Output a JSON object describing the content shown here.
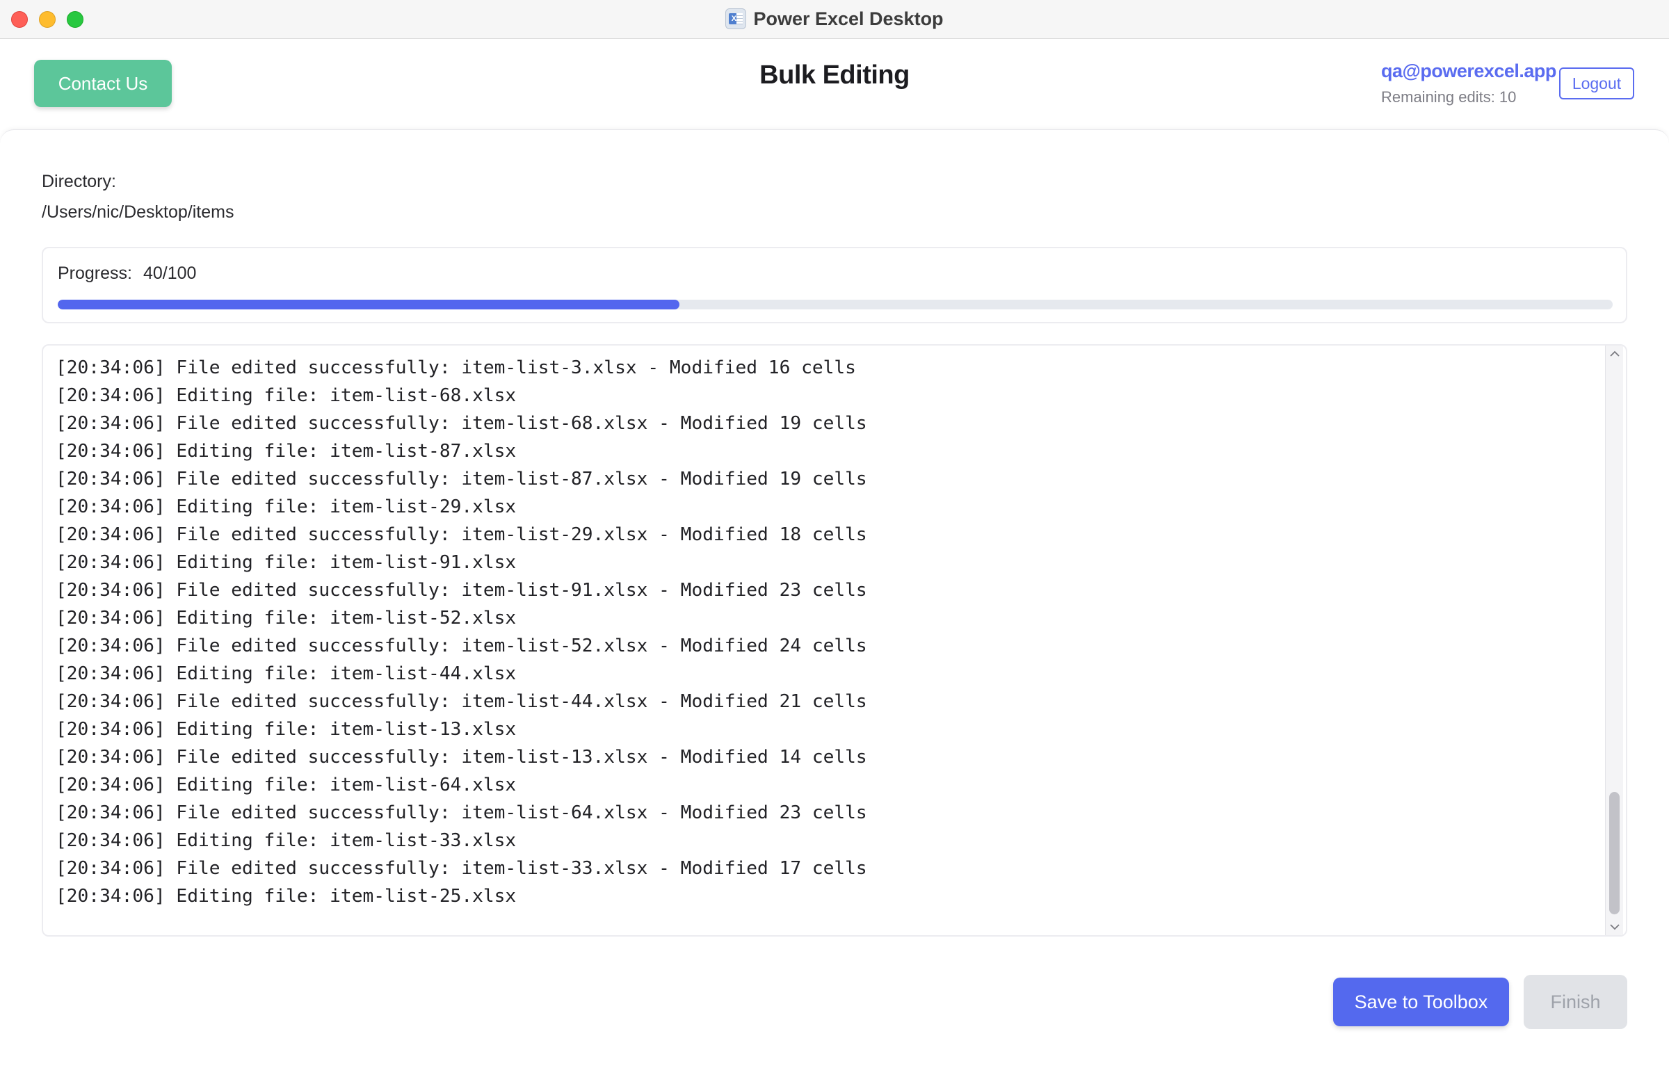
{
  "window": {
    "title": "Power Excel Desktop",
    "icon": "excel-app-icon",
    "icon_letter": "X"
  },
  "header": {
    "contact_label": "Contact Us",
    "page_title": "Bulk Editing",
    "user_email": "qa@powerexcel.app",
    "remaining_label": "Remaining edits:",
    "remaining_count": "10",
    "logout_label": "Logout"
  },
  "directory": {
    "label": "Directory:",
    "path": "/Users/nic/Desktop/items"
  },
  "progress": {
    "label": "Progress:",
    "text": "40/100",
    "done": 40,
    "total": 100,
    "fraction": 0.4
  },
  "log": {
    "lines": [
      "[20:34:06] File edited successfully: item-list-3.xlsx - Modified 16 cells",
      "[20:34:06] Editing file: item-list-68.xlsx",
      "[20:34:06] File edited successfully: item-list-68.xlsx - Modified 19 cells",
      "[20:34:06] Editing file: item-list-87.xlsx",
      "[20:34:06] File edited successfully: item-list-87.xlsx - Modified 19 cells",
      "[20:34:06] Editing file: item-list-29.xlsx",
      "[20:34:06] File edited successfully: item-list-29.xlsx - Modified 18 cells",
      "[20:34:06] Editing file: item-list-91.xlsx",
      "[20:34:06] File edited successfully: item-list-91.xlsx - Modified 23 cells",
      "[20:34:06] Editing file: item-list-52.xlsx",
      "[20:34:06] File edited successfully: item-list-52.xlsx - Modified 24 cells",
      "[20:34:06] Editing file: item-list-44.xlsx",
      "[20:34:06] File edited successfully: item-list-44.xlsx - Modified 21 cells",
      "[20:34:06] Editing file: item-list-13.xlsx",
      "[20:34:06] File edited successfully: item-list-13.xlsx - Modified 14 cells",
      "[20:34:06] Editing file: item-list-64.xlsx",
      "[20:34:06] File edited successfully: item-list-64.xlsx - Modified 23 cells",
      "[20:34:06] Editing file: item-list-33.xlsx",
      "[20:34:06] File edited successfully: item-list-33.xlsx - Modified 17 cells",
      "[20:34:06] Editing file: item-list-25.xlsx"
    ]
  },
  "actions": {
    "save_label": "Save to Toolbox",
    "finish_label": "Finish"
  },
  "colors": {
    "contact_green": "#5cc69a",
    "accent_blue": "#5469ee",
    "progress_fill": "#5366ee",
    "finish_disabled_bg": "#e1e3e7"
  }
}
